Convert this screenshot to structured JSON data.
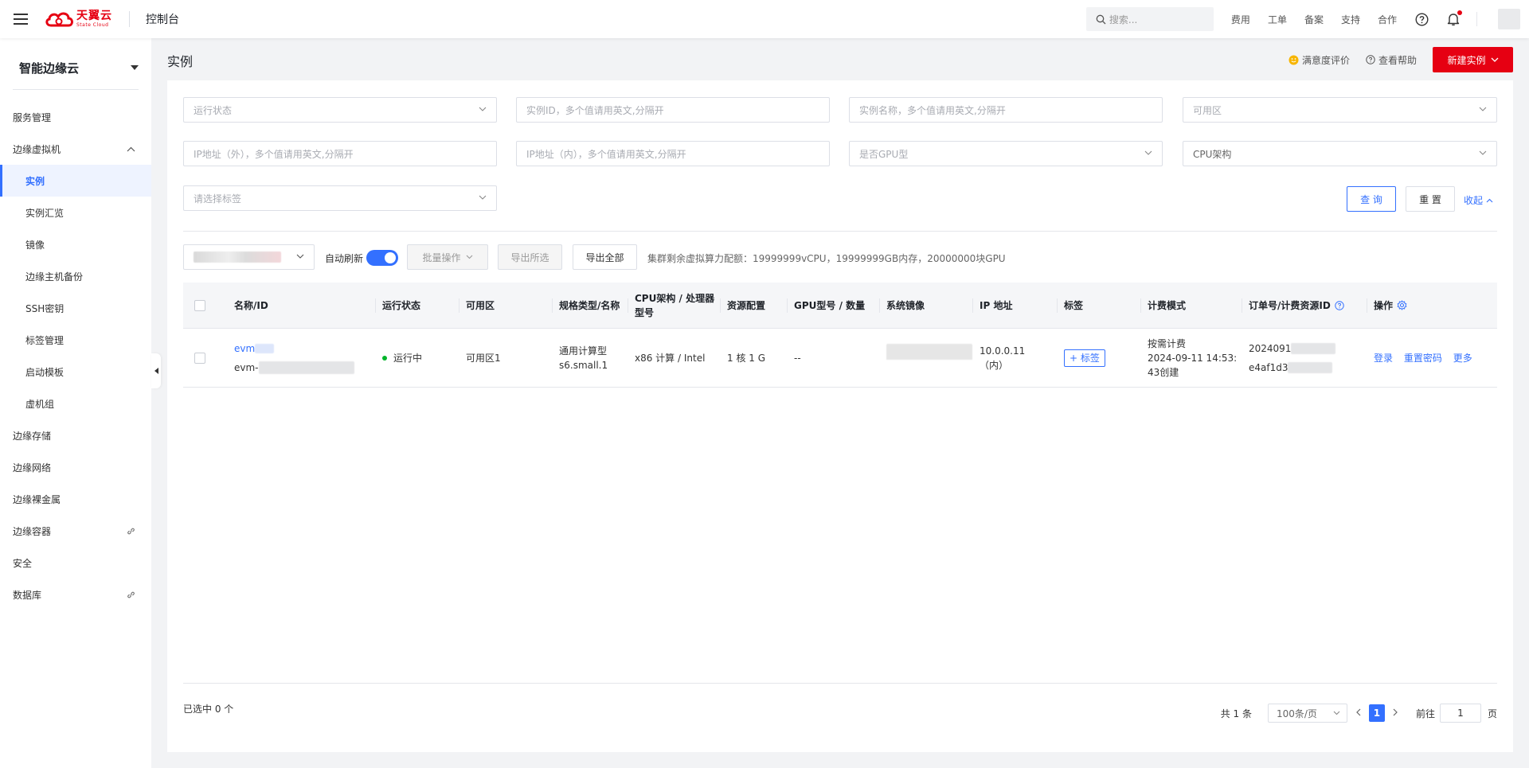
{
  "topbar": {
    "logo_cn": "天翼云",
    "logo_en": "State Cloud",
    "console": "控制台",
    "search_placeholder": "搜索...",
    "links": [
      "费用",
      "工单",
      "备案",
      "支持",
      "合作"
    ]
  },
  "sidebar": {
    "product": "智能边缘云",
    "items": [
      {
        "label": "服务管理"
      },
      {
        "label": "边缘虚拟机"
      },
      {
        "label": "实例"
      },
      {
        "label": "实例汇览"
      },
      {
        "label": "镜像"
      },
      {
        "label": "边缘主机备份"
      },
      {
        "label": "SSH密钥"
      },
      {
        "label": "标签管理"
      },
      {
        "label": "启动模板"
      },
      {
        "label": "虚机组"
      },
      {
        "label": "边缘存储"
      },
      {
        "label": "边缘网络"
      },
      {
        "label": "边缘裸金属"
      },
      {
        "label": "边缘容器"
      },
      {
        "label": "安全"
      },
      {
        "label": "数据库"
      }
    ]
  },
  "header": {
    "title": "实例",
    "rating": "满意度评价",
    "help": "查看帮助",
    "create": "新建实例"
  },
  "filters": {
    "run_status": "运行状态",
    "instance_id": "实例ID，多个值请用英文,分隔开",
    "instance_name": "实例名称，多个值请用英文,分隔开",
    "zone": "可用区",
    "ip_external": "IP地址（外），多个值请用英文,分隔开",
    "ip_internal": "IP地址（内），多个值请用英文,分隔开",
    "gpu_type": "是否GPU型",
    "cpu_arch": "CPU架构",
    "tag": "请选择标签",
    "query": "查 询",
    "reset": "重 置",
    "collapse": "收起"
  },
  "toolbar": {
    "auto_refresh": "自动刷新",
    "batch": "批量操作",
    "export_selected": "导出所选",
    "export_all": "导出全部",
    "quota": "集群剩余虚拟算力配额：19999999vCPU，19999999GB内存，20000000块GPU"
  },
  "table": {
    "headers": [
      "名称/ID",
      "运行状态",
      "可用区",
      "规格类型/名称",
      "CPU架构 / 处理器型号",
      "资源配置",
      "GPU型号 / 数量",
      "系统镜像",
      "IP 地址",
      "标签",
      "计费模式",
      "订单号/计费资源ID",
      "操作"
    ],
    "rows": [
      {
        "name": "evm",
        "id_prefix": "evm-",
        "status": "运行中",
        "zone": "可用区1",
        "spec_type": "通用计算型",
        "spec_name": "s6.small.1",
        "cpu": "x86 计算 / Intel",
        "resource": "1 核 1 G",
        "gpu": "--",
        "ip": "10.0.0.11",
        "ip_type": "（内）",
        "tag_btn": "+ 标签",
        "billing_mode": "按需计费",
        "billing_time": "2024-09-11 14:53:43创建",
        "order_prefix": "2024091",
        "resource_prefix": "e4af1d3",
        "actions": [
          "登录",
          "重置密码",
          "更多"
        ]
      }
    ]
  },
  "footer": {
    "selected": "已选中 0 个",
    "total": "共 1 条",
    "page_size": "100条/页",
    "current_page": "1",
    "goto_label": "前往",
    "goto_value": "1",
    "page_unit": "页"
  }
}
